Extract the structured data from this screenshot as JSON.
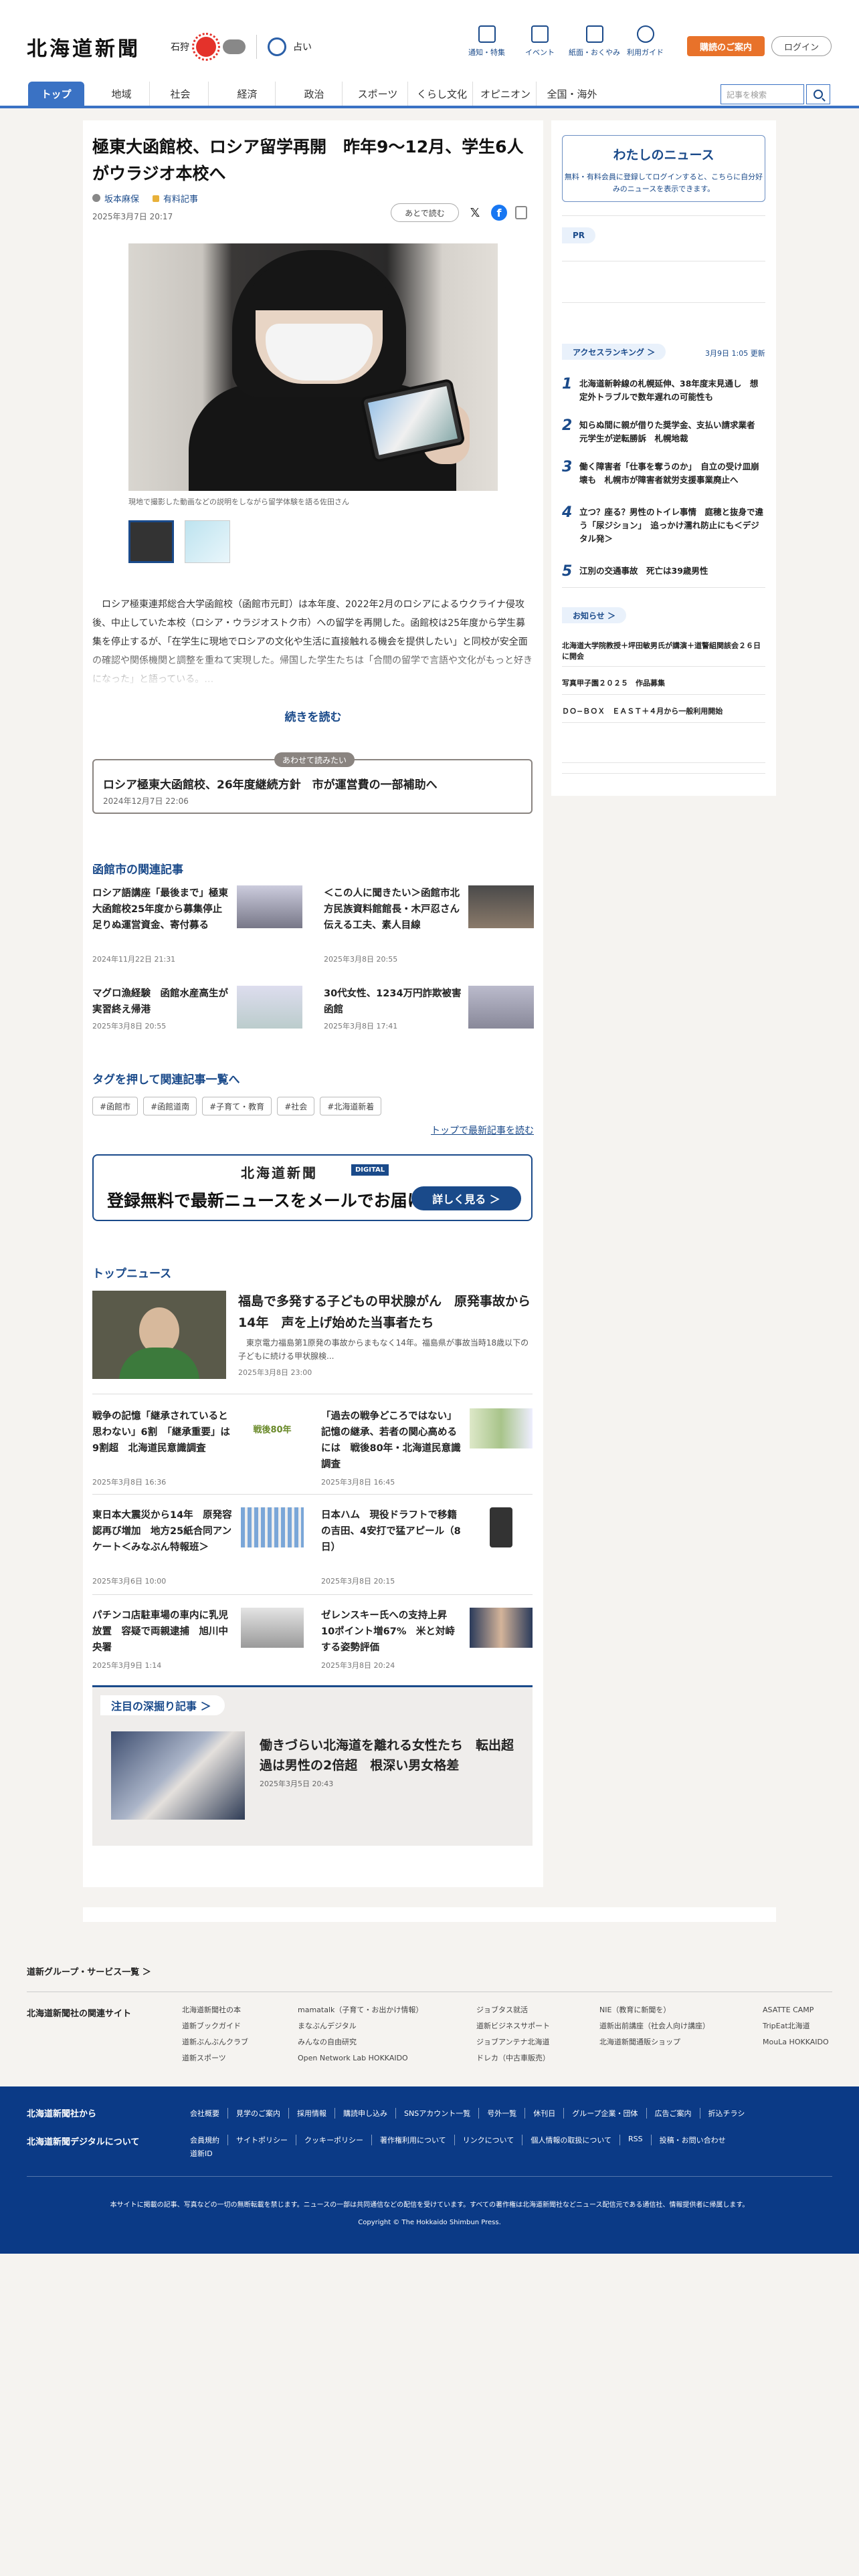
{
  "header": {
    "logo": "北海道新聞",
    "weather_city": "石狩",
    "fortune": "占い",
    "nav_icons": [
      {
        "label": "通知・特集",
        "icon": "flag-icon"
      },
      {
        "label": "イベント",
        "icon": "calendar-icon"
      },
      {
        "label": "紙面・おくやみ",
        "icon": "newspaper-icon"
      },
      {
        "label": "利用ガイド",
        "icon": "question-icon"
      }
    ],
    "subscribe": "購読のご案内",
    "login": "ログイン"
  },
  "nav": {
    "tabs": [
      "トップ",
      "地域",
      "社会",
      "経済",
      "政治",
      "スポーツ",
      "くらし文化",
      "オピニオン",
      "全国・海外"
    ],
    "search_placeholder": "記事を検索"
  },
  "article": {
    "title": "極東大函館校、ロシア留学再開　昨年9〜12月、学生6人がウラジオ本校へ",
    "author": "坂本麻保",
    "member_label": "有料記事",
    "date": "2025年3月7日 20:17",
    "read_later": "あとで読む",
    "photo_caption": "現地で撮影した動画などの説明をしながら留学体験を語る佐田さん",
    "lead": "　ロシア極東連邦総合大学函館校（函館市元町）は本年度、2022年2月のロシアによるウクライナ侵攻後、中止していた本校（ロシア・ウラジオストク市）への留学を再開した。函館校は25年度から学生募集を停止するが、「在学生に現地でロシアの文化や生活に直接触れる機会を提供したい」と同校が安全面の確認や関係機関と調整を重ねて実現した。帰国した学生たちは「合間の留学で言語や文化がもっと好きになった」と語っている。…",
    "read_more": "続きを読む"
  },
  "also_read": {
    "tag": "あわせて読みたい",
    "title": "ロシア極東大函館校、26年度継続方針　市が運営費の一部補助へ",
    "date": "2024年12月7日 22:06"
  },
  "related": {
    "heading": "函館市の関連記事",
    "items": [
      {
        "title": "ロシア語講座「最後まで」極東大函館校25年度から募集停止　足りぬ運営資金、寄付募る",
        "date": "2024年11月22日 21:31"
      },
      {
        "title": "＜この人に聞きたい＞函館市北方民族資料館館長・木戸忍さん　伝える工夫、素人目線",
        "date": "2025年3月8日 20:55"
      },
      {
        "title": "マグロ漁経験　函館水産高生が実習終え帰港",
        "date": "2025年3月8日 20:55"
      },
      {
        "title": "30代女性、1234万円詐欺被害　函館",
        "date": "2025年3月8日 17:41"
      }
    ]
  },
  "tags": {
    "heading": "タグを押して関連記事一覧へ",
    "items": [
      "#函館市",
      "#函館道南",
      "#子育て・教育",
      "#社会",
      "#北海道新着"
    ],
    "to_top": "トップで最新記事を読む"
  },
  "digital": {
    "logo": "北海道新聞",
    "badge": "DIGITAL",
    "message": "登録無料で最新ニュースをメールでお届け",
    "button": "詳しく見る ＞"
  },
  "top_news": {
    "heading": "トップニュース",
    "main": {
      "title": "福島で多発する子どもの甲状腺がん　原発事故から14年　声を上げ始めた当事者たち",
      "desc": "　東京電力福島第1原発の事故からまもなく14年。福島県が事故当時18歳以下の子どもに続ける甲状腺検...",
      "date": "2025年3月8日 23:00"
    },
    "items": [
      {
        "title": "戦争の記憶「継承されていると思わない」6割　「継承重要」は9割超　北海道民意識調査",
        "date": "2025年3月8日 16:36"
      },
      {
        "title": "「過去の戦争どころではない」　記憶の継承、若者の関心高めるには　戦後80年・北海道民意識調査",
        "date": "2025年3月8日 16:45"
      },
      {
        "title": "東日本大震災から14年　原発容認再び増加　地方25紙合同アンケート＜みなぶん特報班＞",
        "date": "2025年3月6日 10:00"
      },
      {
        "title": "日本ハム　現役ドラフトで移籍の吉田、4安打で猛アピール（8日）",
        "date": "2025年3月8日 20:15"
      },
      {
        "title": "パチンコ店駐車場の車内に乳児放置　容疑で両親逮捕　旭川中央署",
        "date": "2025年3月9日 1:14"
      },
      {
        "title": "ゼレンスキー氏への支持上昇　10ポイント増67%　米と対峙する姿勢評価",
        "date": "2025年3月8日 20:24"
      }
    ],
    "badge80": "戦後80年"
  },
  "deep": {
    "heading": "注目の深掘り記事 ＞",
    "title": "働きづらい北海道を離れる女性たち　転出超過は男性の2倍超　根深い男女格差",
    "date": "2025年3月5日 20:43"
  },
  "sidebar": {
    "mynews_title": "わたしのニュース",
    "mynews_text": "無料・有料会員に登録してログインすると、こちらに自分好みのニュースを表示できます。",
    "mynews_link": "ログイン",
    "pr": "PR",
    "ranking_heading": "アクセスランキング ＞",
    "ranking_updated": "3月9日 1:05 更新",
    "ranking": [
      "北海道新幹線の札幌延伸、38年度末見通し　想定外トラブルで数年遅れの可能性も",
      "知らぬ間に親が借りた奨学金、支払い請求業者　元学生が逆転勝訴　札幌地裁",
      "働く障害者「仕事を奪うのか」　自立の受け皿崩壊も　札幌市が障害者就労支援事業廃止へ",
      "立つ？座る？男性のトイレ事情　庭穂と抜身で違う「尿ジション」　追っかけ濡れ防止にも＜デジタル発＞",
      "江別の交通事故　死亡は39歳男性"
    ],
    "notice_heading": "お知らせ ＞",
    "notices": [
      "北海道大学院教授＋坪田敏男氏が講演＋道警組関該会２６日に開会",
      "写真甲子園２０２５　作品募集",
      "ＤＯ−ＢＯＸ　ＥＡＳＴ＋４月から一般利用開始"
    ]
  },
  "footer": {
    "group": "道新グループ・サービス一覧 ＞",
    "related_site": "北海道新聞社の関連サイト",
    "sites": [
      [
        "北海道新聞社の本",
        "道新ブックガイド",
        "道新ぶんぶんクラブ",
        "道新スポーツ"
      ],
      [
        "mamatalk（子育て・お出かけ情報）",
        "まなぶんデジタル",
        "みんなの自由研究",
        "Open Network Lab HOKKAIDO"
      ],
      [
        "ジョブタス就活",
        "道新ビジネスサポート",
        "ジョブアンテナ北海道",
        "ドレカ（中古車販売）"
      ],
      [
        "NIE（教育に新聞を）",
        "道新出前講座（社会人向け講座）",
        "北海道新聞通販ショップ"
      ],
      [
        "ASATTE CAMP",
        "TripEat北海道",
        "MouLa HOKKAIDO"
      ]
    ],
    "from_company": "北海道新聞社から",
    "about_digital": "北海道新聞デジタルについて",
    "links1": [
      "会社概要",
      "見学のご案内",
      "採用情報",
      "購読申し込み",
      "SNSアカウント一覧",
      "号外一覧",
      "休刊日",
      "グループ企業・団体",
      "広告ご案内",
      "折込チラシ"
    ],
    "links2": [
      "会員規約",
      "サイトポリシー",
      "クッキーポリシー",
      "著作権利用について",
      "リンクについて",
      "個人情報の取扱について",
      "RSS",
      "投稿・お問い合わせ",
      "道新ID"
    ],
    "notice": "本サイトに掲載の記事、写真などの一切の無断転載を禁じます。ニュースの一部は共同通信などの配信を受けています。すべての著作権は北海道新聞社などニュース配信元である通信社、情報提供者に帰属します。",
    "copyright": "Copyright © The Hokkaido Shimbun Press."
  }
}
